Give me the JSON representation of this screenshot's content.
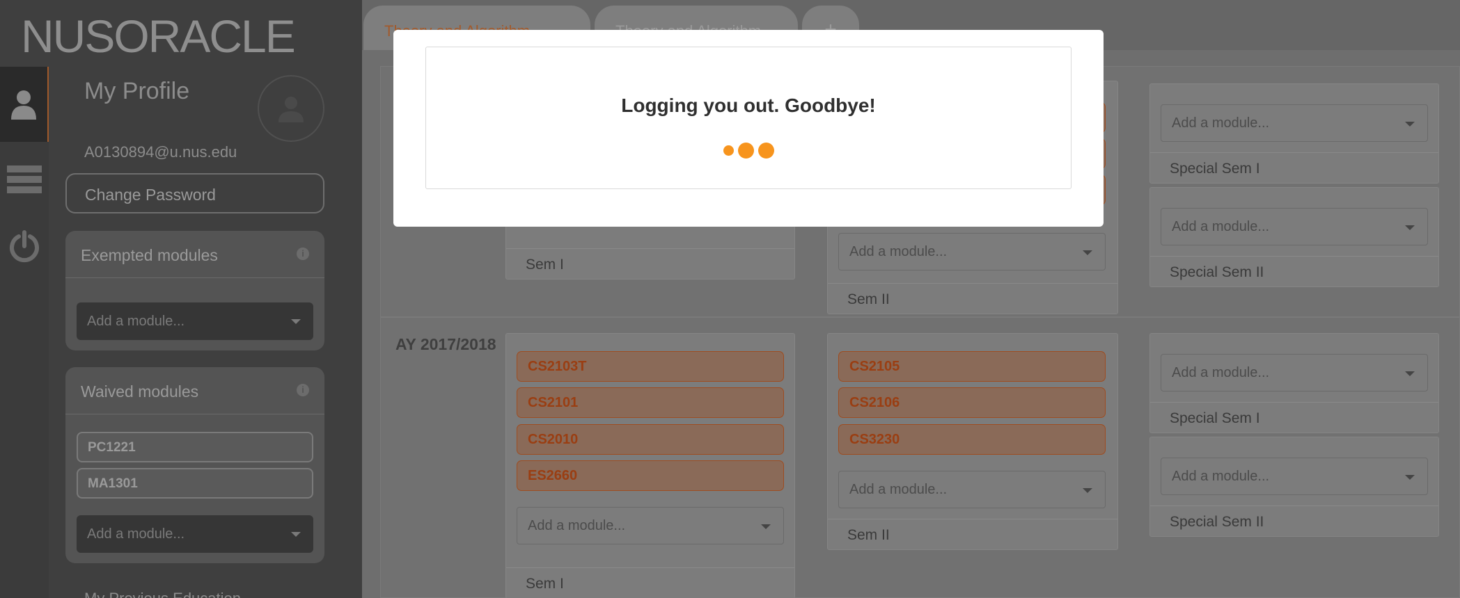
{
  "app": {
    "logo": "NUSORACLE"
  },
  "sidebar": {
    "profile_title": "My Profile",
    "email": "A0130894@u.nus.edu",
    "change_password": "Change Password",
    "exempted": {
      "title": "Exempted modules",
      "placeholder": "Add a module..."
    },
    "waived": {
      "title": "Waived modules",
      "modules": [
        "PC1221",
        "MA1301"
      ],
      "placeholder": "Add a module..."
    },
    "previous_education": "My Previous Education"
  },
  "tabs": [
    {
      "label": "Theory and Algorithm"
    },
    {
      "label": "Theory and Algorithm"
    },
    {
      "label": "+"
    }
  ],
  "planner": {
    "row1": {
      "col1_foot": "Sem I",
      "col2_placeholder": "Add a module...",
      "col2_foot": "Sem II",
      "col3a_placeholder": "Add a module...",
      "col3a_foot": "Special Sem I",
      "col3b_placeholder": "Add a module...",
      "col3b_foot": "Special Sem II"
    },
    "row2": {
      "year": "AY 2017/2018",
      "sem1": {
        "modules": [
          "CS2103T",
          "CS2101",
          "CS2010",
          "ES2660"
        ],
        "placeholder": "Add a module...",
        "foot": "Sem I"
      },
      "sem2": {
        "modules": [
          "CS2105",
          "CS2106",
          "CS3230"
        ],
        "placeholder": "Add a module...",
        "foot": "Sem II"
      },
      "special1": {
        "placeholder": "Add a module...",
        "foot": "Special Sem I"
      },
      "special2": {
        "placeholder": "Add a module...",
        "foot": "Special Sem II"
      }
    }
  },
  "modal": {
    "message": "Logging you out. Goodbye!"
  },
  "colors": {
    "accent": "#f7941d",
    "module": "#d4510f"
  }
}
